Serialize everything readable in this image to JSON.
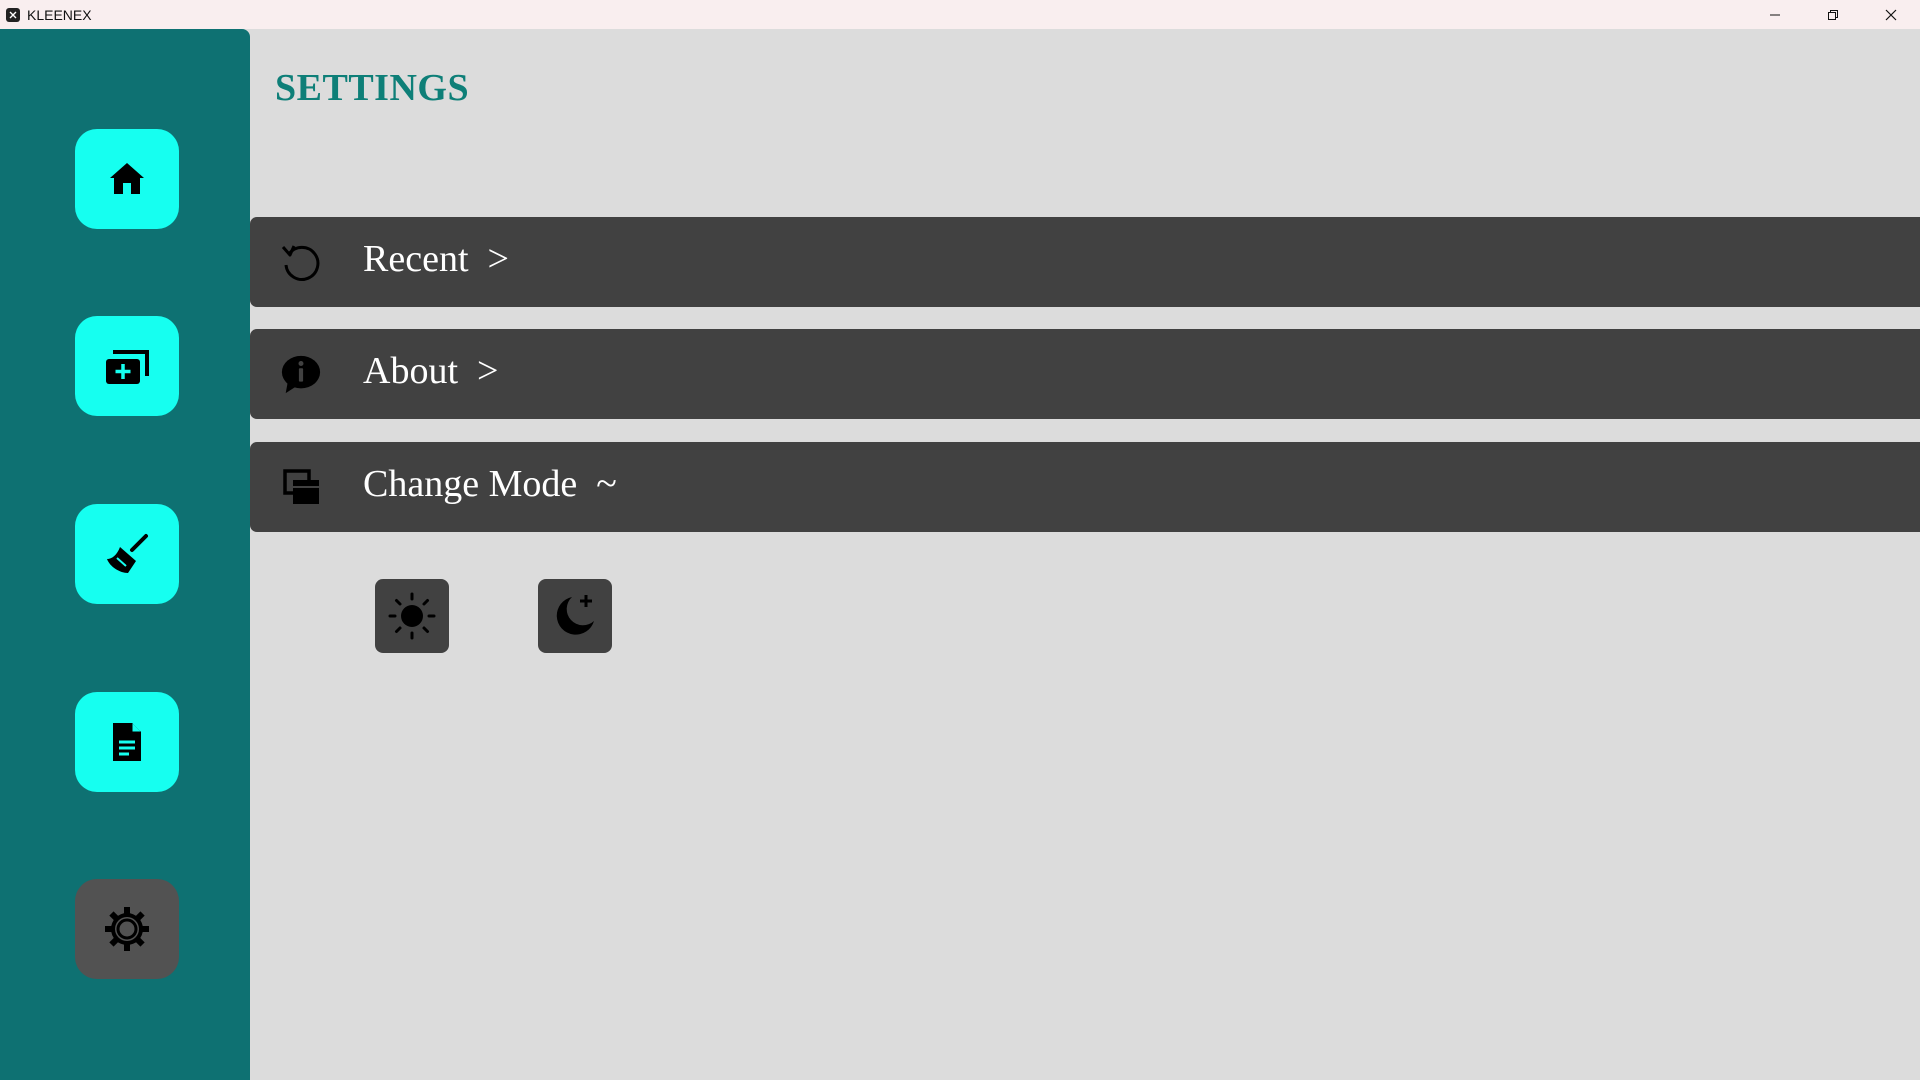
{
  "window": {
    "title": "KLEENEX",
    "app_icon": "kleenex-app-icon",
    "controls": [
      "minimize-icon",
      "restore-icon",
      "close-icon"
    ]
  },
  "sidebar": {
    "items": [
      {
        "name": "home",
        "icon": "home-icon",
        "active": false
      },
      {
        "name": "add",
        "icon": "add-copy-icon",
        "active": false
      },
      {
        "name": "clean",
        "icon": "broom-icon",
        "active": false
      },
      {
        "name": "document",
        "icon": "document-icon",
        "active": false
      },
      {
        "name": "settings",
        "icon": "gear-icon",
        "active": true
      }
    ]
  },
  "main": {
    "title": "SETTINGS",
    "rows": [
      {
        "label": "Recent  >",
        "icon": "history-icon"
      },
      {
        "label": "About  >",
        "icon": "info-bubble-icon"
      },
      {
        "label": "Change Mode  ~",
        "icon": "mode-stack-icon"
      }
    ],
    "mode_buttons": [
      {
        "icon": "sun-icon"
      },
      {
        "icon": "moon-stars-icon"
      }
    ]
  },
  "colors": {
    "sidebar": "#0e7172",
    "nav_button": "#16fff0",
    "nav_button_active": "#525252",
    "title": "#0e7f78",
    "row": "#414141",
    "background": "#dcdcdc"
  }
}
